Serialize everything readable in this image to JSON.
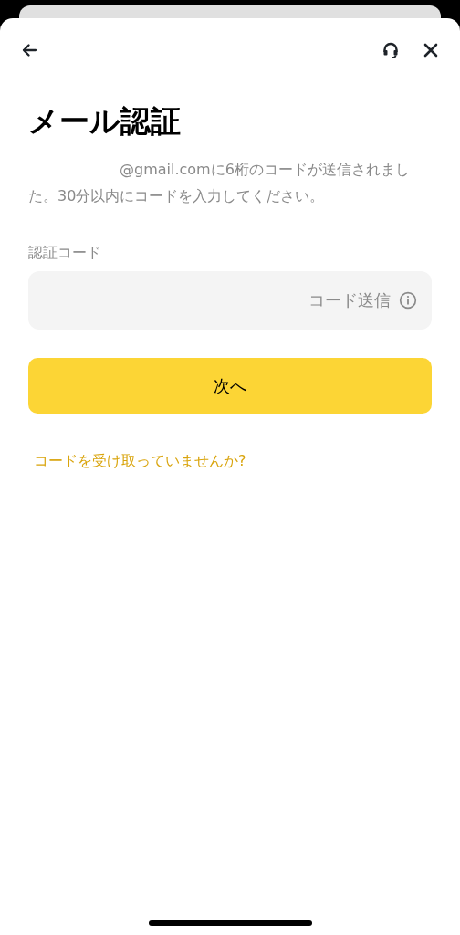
{
  "title": "メール認証",
  "message": "@gmail.comに6桁のコードが送信されました。30分以内にコードを入力してください。",
  "code_field": {
    "label": "認証コード",
    "send_button": "コード送信"
  },
  "next_button": "次へ",
  "help_link": "コードを受け取っていませんか?"
}
